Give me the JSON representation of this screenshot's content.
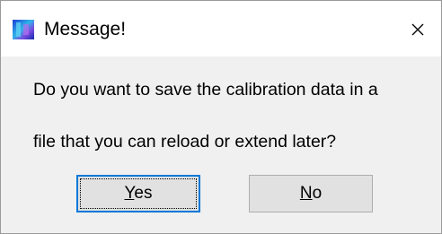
{
  "window": {
    "title": "Message!",
    "icon": "application-icon",
    "close_icon": "close-icon"
  },
  "message": {
    "line1": "Do you want to save the calibration data in a",
    "line2": "file that you can reload or extend later?"
  },
  "buttons": {
    "yes": {
      "accel": "Y",
      "rest": "es"
    },
    "no": {
      "accel": "N",
      "rest": "o"
    }
  },
  "colors": {
    "focus_border": "#0078d7",
    "button_face": "#e1e1e1",
    "dialog_body": "#f0f0f0",
    "titlebar": "#ffffff"
  }
}
